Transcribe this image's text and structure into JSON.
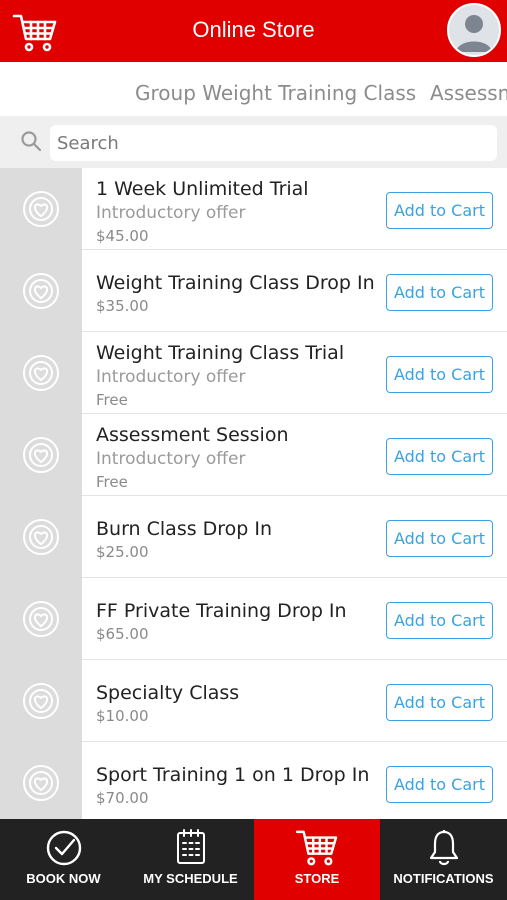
{
  "header": {
    "title": "Online Store",
    "cart_icon": "cart-icon",
    "avatar_icon": "user-avatar-icon"
  },
  "tabs": [
    {
      "label": "Group Weight Training Class"
    },
    {
      "label": "Assessment"
    }
  ],
  "search": {
    "placeholder": "Search",
    "value": ""
  },
  "items": [
    {
      "title": "1 Week Unlimited Trial",
      "subtitle": "Introductory offer",
      "price": "$45.00",
      "button": "Add to Cart"
    },
    {
      "title": "Weight Training Class Drop In",
      "subtitle": "",
      "price": "$35.00",
      "button": "Add to Cart"
    },
    {
      "title": "Weight Training Class Trial",
      "subtitle": "Introductory offer",
      "price": "Free",
      "button": "Add to Cart"
    },
    {
      "title": "Assessment Session",
      "subtitle": "Introductory offer",
      "price": "Free",
      "button": "Add to Cart"
    },
    {
      "title": "Burn Class Drop In",
      "subtitle": "",
      "price": "$25.00",
      "button": "Add to Cart"
    },
    {
      "title": "FF Private Training Drop In",
      "subtitle": "",
      "price": "$65.00",
      "button": "Add to Cart"
    },
    {
      "title": "Specialty Class",
      "subtitle": "",
      "price": "$10.00",
      "button": "Add to Cart"
    },
    {
      "title": "Sport Training 1 on 1 Drop In",
      "subtitle": "",
      "price": "$70.00",
      "button": "Add to Cart"
    }
  ],
  "bottom_nav": [
    {
      "label": "BOOK NOW",
      "icon": "checkmark-circle-icon",
      "active": false
    },
    {
      "label": "MY SCHEDULE",
      "icon": "calendar-icon",
      "active": false
    },
    {
      "label": "STORE",
      "icon": "cart-icon",
      "active": true
    },
    {
      "label": "NOTIFICATIONS",
      "icon": "bell-icon",
      "active": false
    }
  ],
  "colors": {
    "brand_red": "#e00000",
    "link_blue": "#3aa3df",
    "nav_dark": "#222222",
    "thumb_gray": "#dcdcdc"
  }
}
